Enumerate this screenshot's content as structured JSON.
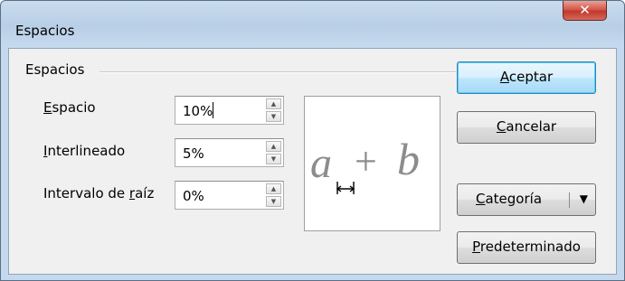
{
  "window": {
    "title": "Espacios",
    "close_icon": "close-icon"
  },
  "group": {
    "label": "Espacios"
  },
  "fields": [
    {
      "label_pre": "",
      "label_ul": "E",
      "label_post": "spacio",
      "value": "10%"
    },
    {
      "label_pre": "",
      "label_ul": "I",
      "label_post": "nterlineado",
      "value": "5%"
    },
    {
      "label_pre": "Intervalo de ",
      "label_ul": "r",
      "label_post": "aíz",
      "value": "0%"
    }
  ],
  "preview": {
    "formula_a": "a",
    "formula_op": "+",
    "formula_b": "b",
    "icon": "horizontal-spacing-icon"
  },
  "buttons": {
    "accept": {
      "ul": "A",
      "rest": "ceptar"
    },
    "cancel": {
      "ul": "C",
      "rest": "ancelar"
    },
    "category": {
      "ul": "C",
      "rest": "ategoría",
      "arrow": "▼"
    },
    "default": {
      "ul": "P",
      "rest": "redeterminado"
    }
  },
  "colors": {
    "preview_text": "#8c8c8c",
    "default_button_border": "#3c7fb1",
    "close_button": "#c0392b"
  }
}
